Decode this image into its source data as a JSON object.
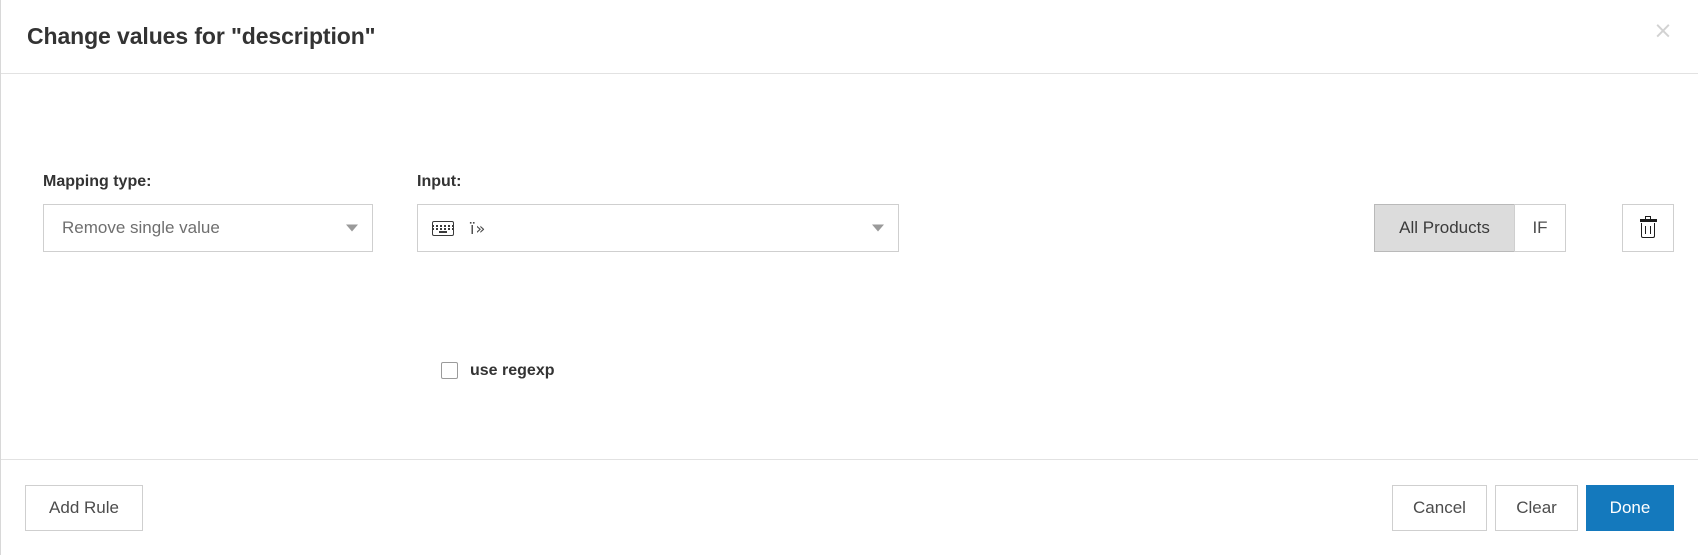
{
  "dialog": {
    "title": "Change values for \"description\"",
    "close_icon_label": "×"
  },
  "rule": {
    "mapping_type": {
      "label": "Mapping type:",
      "selected": "Remove single value",
      "caret_icon": "chevron-down-icon"
    },
    "input": {
      "label": "Input:",
      "icon": "keyboard-icon",
      "value": "ï»",
      "placeholder": "",
      "caret_icon": "chevron-down-icon"
    },
    "regexp": {
      "label": "use regexp",
      "checked": false
    },
    "scope_toggle": {
      "options": [
        {
          "label": "All Products",
          "active": true
        },
        {
          "label": "IF",
          "active": false
        }
      ]
    },
    "delete": {
      "icon": "trash-icon",
      "tooltip": "Delete rule"
    }
  },
  "footer": {
    "add_rule_label": "Add Rule",
    "cancel_label": "Cancel",
    "clear_label": "Clear",
    "done_label": "Done"
  },
  "colors": {
    "primary": "#1479bd",
    "border": "#cfcfcf",
    "text": "#333333",
    "muted_text": "#6f6f6f",
    "segment_active_bg": "#dcdcdc"
  }
}
